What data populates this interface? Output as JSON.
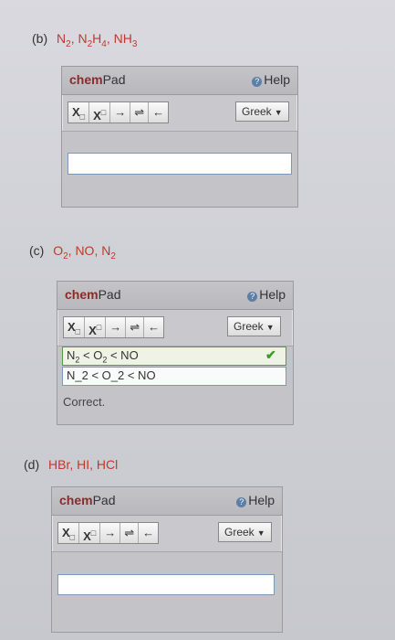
{
  "questions": [
    {
      "label": "(b)",
      "formula_parts": [
        "N",
        "2",
        ", N",
        "2",
        "H",
        "4",
        ", NH",
        "3"
      ]
    },
    {
      "label": "(c)",
      "formula_parts": [
        "O",
        "2",
        ", NO, N",
        "2"
      ]
    },
    {
      "label": "(d)",
      "formula": "HBr, HI, HCl"
    }
  ],
  "chempad": {
    "title_bold": "chem",
    "title_rest": "Pad",
    "help_label": "Help",
    "help_icon": "?",
    "tool_sub": "X",
    "tool_sup": "X",
    "tool_arrow": "→",
    "tool_equilibrium": "⇌",
    "tool_back": "←",
    "greek_label": "Greek",
    "greek_arrow": "▼"
  },
  "answer_c": {
    "rendered_parts": [
      "N",
      "2",
      " < O",
      "2",
      " < NO"
    ],
    "raw_text": "N_2 < O_2 < NO",
    "status": "Correct.",
    "check_icon": "✔"
  }
}
